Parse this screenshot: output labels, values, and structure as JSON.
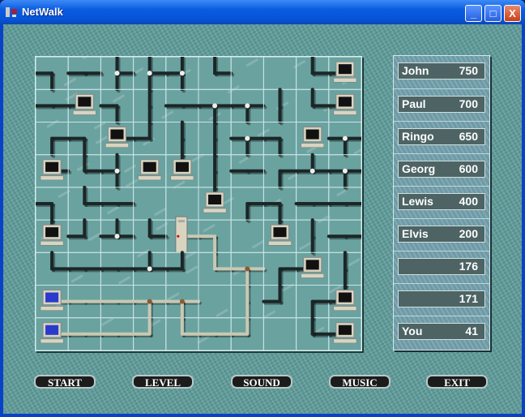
{
  "window": {
    "title": "NetWalk",
    "app_icon": "netwalk-icon",
    "minimize": "_",
    "maximize": "□",
    "close": "X"
  },
  "colors": {
    "pipe": "#1b2627",
    "lit_pipe": "#c9c8b2",
    "tile": "#6aa2a0",
    "grid": "#c8e4e4"
  },
  "board": {
    "columns": 10,
    "rows": 9,
    "tiles": [
      [
        "WS",
        "EW",
        "NSE",
        "NSE",
        "WNS",
        "NE",
        "",
        "",
        "NE",
        "C:W"
      ],
      [
        "EW",
        "C:W",
        "WS",
        "NS",
        "WE",
        "WES",
        "WES",
        "NS",
        "NE",
        "C:W"
      ],
      [
        "ES",
        "WS",
        "C:E",
        "NW",
        "NS",
        "NS",
        "WES",
        "WS",
        "C:",
        "WES"
      ],
      [
        "C:E",
        "NE",
        "WNS",
        "C:",
        "C:N",
        "NS",
        "WE",
        "ES",
        "WEN",
        "WES"
      ],
      [
        "WS",
        "NE",
        "WE",
        "",
        "",
        "C:N",
        "ES",
        "WS",
        "WE",
        "WE"
      ],
      [
        "C:N",
        "NW",
        "WEN",
        "NE",
        "*S:E",
        "*WS",
        "",
        "C:N",
        "NS",
        "WE"
      ],
      [
        "NE",
        "WE",
        "WE",
        "WEN",
        "WN",
        "*NE",
        "*WES",
        "ES",
        "C:W",
        "NS"
      ],
      [
        "*B:E",
        "*WE",
        "*WE",
        "*WES",
        "*WES",
        "",
        "*NS",
        "NW",
        "ES",
        "C:WN"
      ],
      [
        "*B:E",
        "*WE",
        "*WE",
        "*WN",
        "*NE",
        "*WE",
        "*WN",
        "",
        "EN",
        "C:W"
      ]
    ]
  },
  "scores": [
    {
      "name": "John",
      "score": "750"
    },
    {
      "name": "Paul",
      "score": "700"
    },
    {
      "name": "Ringo",
      "score": "650"
    },
    {
      "name": "Georg",
      "score": "600"
    },
    {
      "name": "Lewis",
      "score": "400"
    },
    {
      "name": "Elvis",
      "score": "200"
    },
    {
      "name": "",
      "score": "176"
    },
    {
      "name": "",
      "score": "171"
    },
    {
      "name": "You",
      "score": "41"
    }
  ],
  "buttons": {
    "start": "START",
    "level": "LEVEL",
    "sound": "SOUND",
    "music": "MUSIC",
    "exit": "EXIT"
  }
}
